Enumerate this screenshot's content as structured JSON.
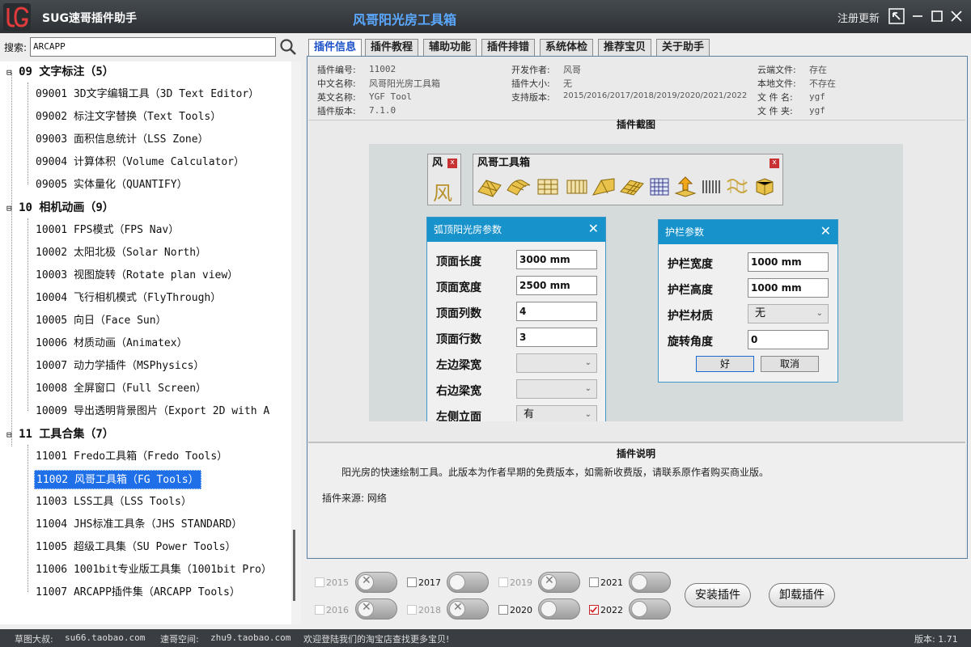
{
  "app": {
    "title": "SUG速哥插件助手",
    "center_title": "风哥阳光房工具箱",
    "register": "注册更新"
  },
  "search": {
    "label": "搜索:",
    "value": "ARCAPP"
  },
  "tree": {
    "items": [
      {
        "text": "09 文字标注（5）",
        "group": true
      },
      {
        "text": "09001 3D文字编辑工具（3D Text Editor）"
      },
      {
        "text": "09002 标注文字替换（Text Tools）"
      },
      {
        "text": "09003 面积信息统计（LSS Zone）"
      },
      {
        "text": "09004 计算体积（Volume Calculator）"
      },
      {
        "text": "09005 实体量化（QUANTIFY）"
      },
      {
        "text": "10 相机动画（9）",
        "group": true
      },
      {
        "text": "10001 FPS模式（FPS Nav）"
      },
      {
        "text": "10002 太阳北极（Solar North）"
      },
      {
        "text": "10003 视图旋转（Rotate plan view）"
      },
      {
        "text": "10004 飞行相机模式（FlyThrough）"
      },
      {
        "text": "10005 向日（Face Sun）"
      },
      {
        "text": "10006 材质动画（Animatex）"
      },
      {
        "text": "10007 动力学插件（MSPhysics）"
      },
      {
        "text": "10008 全屏窗口（Full Screen）"
      },
      {
        "text": "10009 导出透明背景图片（Export 2D with A"
      },
      {
        "text": "11 工具合集（7）",
        "group": true
      },
      {
        "text": "11001 Fredo工具箱（Fredo Tools）"
      },
      {
        "text": "11002 风哥工具箱（FG Tools）",
        "selected": true
      },
      {
        "text": "11003 LSS工具（LSS Tools）"
      },
      {
        "text": "11004 JHS标准工具条（JHS STANDARD）"
      },
      {
        "text": "11005 超级工具集（SU Power Tools）"
      },
      {
        "text": "11006 1001bit专业版工具集（1001bit Pro）"
      },
      {
        "text": "11007 ARCAPP插件集（ARCAPP Tools）"
      }
    ]
  },
  "tabs": [
    "插件信息",
    "插件教程",
    "辅助功能",
    "插件排错",
    "系统体检",
    "推荐宝贝",
    "关于助手"
  ],
  "info": {
    "col1": [
      {
        "k": "插件编号:",
        "v": "11002"
      },
      {
        "k": "中文名称:",
        "v": "风哥阳光房工具箱"
      },
      {
        "k": "英文名称:",
        "v": "YGF Tool"
      },
      {
        "k": "插件版本:",
        "v": "7.1.0"
      }
    ],
    "col2": [
      {
        "k": "开发作者:",
        "v": "风哥"
      },
      {
        "k": "插件大小:",
        "v": "无"
      },
      {
        "k": "支持版本:",
        "v": "2015/2016/2017/2018/2019/2020/2021/2022"
      }
    ],
    "col3": [
      {
        "k": "云端文件:",
        "v": "存在"
      },
      {
        "k": "本地文件:",
        "v": "不存在"
      },
      {
        "k": "文 件 名:",
        "v": "ygf"
      },
      {
        "k": "文 件 夹:",
        "v": "ygf"
      }
    ]
  },
  "screenshot": {
    "title": "插件截图",
    "small_toolbar": {
      "title": "风",
      "glyph": "风"
    },
    "toolbar": {
      "title": "风哥工具箱"
    },
    "dialog1": {
      "title": "弧顶阳光房参数",
      "fields": [
        {
          "label": "顶面长度",
          "value": "3000 mm"
        },
        {
          "label": "顶面宽度",
          "value": "2500 mm"
        },
        {
          "label": "顶面列数",
          "value": "4"
        },
        {
          "label": "顶面行数",
          "value": "3"
        },
        {
          "label": "左边梁宽",
          "value": ""
        },
        {
          "label": "右边梁宽",
          "value": ""
        },
        {
          "label": "左侧立面",
          "value": "有"
        }
      ]
    },
    "dialog2": {
      "title": "护栏参数",
      "fields": [
        {
          "label": "护栏宽度",
          "value": "1000 mm"
        },
        {
          "label": "护栏高度",
          "value": "1000 mm"
        },
        {
          "label": "护栏材质",
          "value": "无"
        },
        {
          "label": "旋转角度",
          "value": "0"
        }
      ],
      "ok": "好",
      "cancel": "取消"
    }
  },
  "description": {
    "title": "插件说明",
    "text": "阳光房的快速绘制工具。此版本为作者早期的免费版本，如需新收费版，请联系原作者购买商业版。",
    "source": "插件来源: 网络"
  },
  "versions": [
    {
      "label": "2015",
      "checked": false,
      "enabled": false
    },
    {
      "label": "2016",
      "checked": false,
      "enabled": false
    },
    {
      "label": "2017",
      "checked": false,
      "enabled": true
    },
    {
      "label": "2018",
      "checked": false,
      "enabled": false
    },
    {
      "label": "2019",
      "checked": false,
      "enabled": false
    },
    {
      "label": "2020",
      "checked": false,
      "enabled": true
    },
    {
      "label": "2021",
      "checked": false,
      "enabled": true
    },
    {
      "label": "2022",
      "checked": true,
      "enabled": true
    }
  ],
  "buttons": {
    "install": "安装插件",
    "uninstall": "卸载插件"
  },
  "status": {
    "uncle_label": "草图大叔:",
    "uncle_url": "su66.taobao.com",
    "space_label": "速哥空间:",
    "space_url": "zhu9.taobao.com",
    "welcome": "欢迎登陆我们的淘宝店查找更多宝贝!",
    "version": "版本: 1.71"
  },
  "colors": {
    "accent": "#1e6fe8",
    "dialog_header": "#1792cb",
    "title_text": "#5aa8ff",
    "checked": "#d9262c"
  }
}
